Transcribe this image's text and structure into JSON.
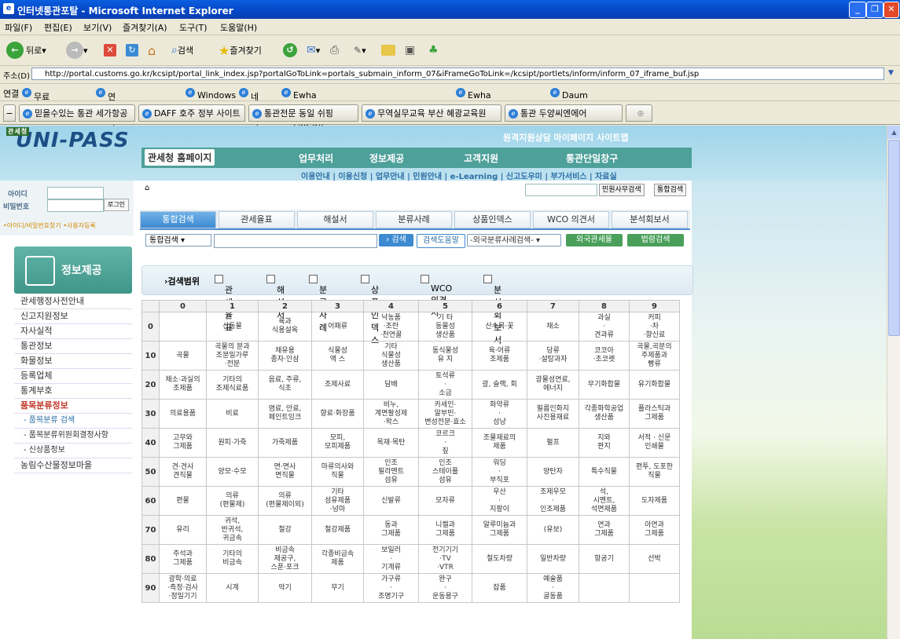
{
  "window": {
    "title": "인터넷통관포탈 - Microsoft Internet Explorer"
  },
  "menu": [
    "파일(F)",
    "편집(E)",
    "보기(V)",
    "즐겨찾기(A)",
    "도구(T)",
    "도움말(H)"
  ],
  "toolbar": {
    "back": "뒤로",
    "search": "검색",
    "favorites": "즐겨찾기"
  },
  "address": {
    "label": "주소(D)",
    "url": "http://portal.customs.go.kr/kcsipt/portal_link_index.jsp?portalGoToLink=portals_submain_inform_07&iFrameGoToLink=/kcsipt/portlets/inform/inform_07_iframe_buf.jsp"
  },
  "links": {
    "label": "연결",
    "items": [
      "무료 Hotmail",
      "연결 사용자 정의",
      "Windows",
      "네이버",
      "Ewha Womans University Library",
      "Ewha CyberCampus",
      "Daum"
    ]
  },
  "browser_tabs": [
    "믿을수있는 통관 세가항공",
    "DAFF 호주 정부 사이트",
    "통관전문 동일 쉬핑",
    "무역실무교육 부산 혜광교육원",
    "통관 두양씨엔에어"
  ],
  "site": {
    "logo": "UNI-PASS",
    "toplinks": "원격지원상담  마이페이지  사이트맵",
    "nav": [
      "관세청 홈페이지",
      "업무처리",
      "정보제공",
      "고객지원",
      "통관단일창구"
    ],
    "subnav": "이용안내 | 이용신청 | 업무안내 | 민원안내 | e-Learning | 신고도우미 | 부가서비스 | 자료실",
    "login": {
      "id_label": "아이디",
      "pw_label": "비밀번호",
      "button": "로그인",
      "links": "•아이디/비밀번호찾기  •사용자등록"
    },
    "search_buttons": [
      "민원사무검색",
      "통합검색"
    ],
    "panel_title": "정보제공",
    "sidebar": [
      "관세행정사전안내",
      "신고지원정보",
      "자사실적",
      "통관정보",
      "화물정보",
      "등록업체",
      "통계부호",
      "품목분류정보",
      "- 품목분류 검색",
      "- 품목분류위원회결정사항",
      "- 신상품정보",
      "농림수산물정보마을"
    ],
    "tabs": [
      "통합검색",
      "관세율표",
      "해설서",
      "분류사례",
      "상품인덱스",
      "WCO 의견서",
      "분석회보서"
    ],
    "query": {
      "select": "통합검색",
      "search_btn": "› 검색",
      "help_btn": "검색도움말",
      "select2": "-외국분류사례검색-",
      "foreign_btn": "외국관세율",
      "law_btn": "법령검색"
    },
    "scope_title": "›검색범위",
    "scope_items": [
      "관세율표",
      "해설서",
      "분류사례",
      "상품인덱스",
      "WCO의견서",
      "분석회보서"
    ]
  },
  "hs_table": {
    "cols": [
      "0",
      "1",
      "2",
      "3",
      "4",
      "5",
      "6",
      "7",
      "8",
      "9"
    ],
    "rows": [
      {
        "h": "0",
        "c": [
          "",
          "산동물",
          "육과\n식용설육",
          "어패류",
          "낙농품\n·조란\n·천연꿀",
          "기 타\n동물성\n생산품",
          "산수목·꽃",
          "채소",
          "과실\n·\n견과류",
          "커피\n·차\n·향신료"
        ]
      },
      {
        "h": "10",
        "c": [
          "곡물",
          "곡물의 분과\n조분밀가루\n·전분",
          "채유용\n종자·인삼",
          "식물성\n액 스",
          "기타\n식물성\n생산품",
          "동식물성\n유 지",
          "육·어류\n조제품",
          "당류\n·설탕과자",
          "코코아\n·초코렛",
          "곡물,곡분의\n주제품과\n빵류"
        ]
      },
      {
        "h": "20",
        "c": [
          "채소·과실의\n조제품",
          "기타의\n조제식료품",
          "음료, 주류,\n식초",
          "조제사료",
          "담배",
          "토석류\n·\n소금",
          "광, 슬랙, 회",
          "광물성연료,\n에너지",
          "무기화합물",
          "유기화합물"
        ]
      },
      {
        "h": "30",
        "c": [
          "의료용품",
          "비료",
          "염료, 안료,\n페인트잉크",
          "향료·화장품",
          "비누,\n계면활성제\n·왁스",
          "카세인·\n알부민·\n변성전분·효소",
          "화약류\n·\n성냥",
          "필름인화지\n사진용재료",
          "각종화학공업\n생산품",
          "플라스틱과\n그제품"
        ]
      },
      {
        "h": "40",
        "c": [
          "고무와\n그제품",
          "원피·가죽",
          "가죽제품",
          "모피,\n모피제품",
          "목재·목탄",
          "코르크\n·\n짚",
          "조물재료의\n제품",
          "펄프",
          "지와\n판지",
          "서적 · 신문\n인쇄물"
        ]
      },
      {
        "h": "50",
        "c": [
          "견·견사\n견직물",
          "양모·수모",
          "면·면사\n면직물",
          "마류의사와\n직물",
          "인조\n필라멘트\n섬유",
          "인조\n스테이플\n섬유",
          "워딩\n·\n부직포",
          "양탄자",
          "특수직물",
          "편투, 도포한\n직물"
        ]
      },
      {
        "h": "60",
        "c": [
          "편물",
          "의류\n(편물제)",
          "의류\n(편물제이외)",
          "기타\n섬유제품\n·넝마",
          "신발류",
          "모자류",
          "우산\n·\n지팡이",
          "조제우모\n·\n인조제품",
          "석,\n시멘트,\n석면제품",
          "도자제품"
        ]
      },
      {
        "h": "70",
        "c": [
          "유리",
          "귀석,\n반귀석,\n귀금속",
          "철강",
          "철강제품",
          "동과\n그제품",
          "니켈과\n그제품",
          "알루미늄과\n그제품",
          "(유보)",
          "연과\n그제품",
          "아연과\n그제품"
        ]
      },
      {
        "h": "80",
        "c": [
          "주석과\n그제품",
          "기타의\n비금속",
          "비금속\n제공구,\n스푼·포크",
          "각종비금속\n제품",
          "보일러\n·\n기계류",
          "전기기기\n·TV\n·VTR",
          "철도차량",
          "일반차량",
          "항공기",
          "선박"
        ]
      },
      {
        "h": "90",
        "c": [
          "광학·의료\n·측정·검사\n·정밀기기",
          "시계",
          "악기",
          "무기",
          "가구류\n·\n조명기구",
          "완구\n·\n운동용구",
          "잡품",
          "예술품\n·\n골동품",
          "",
          ""
        ]
      }
    ]
  }
}
